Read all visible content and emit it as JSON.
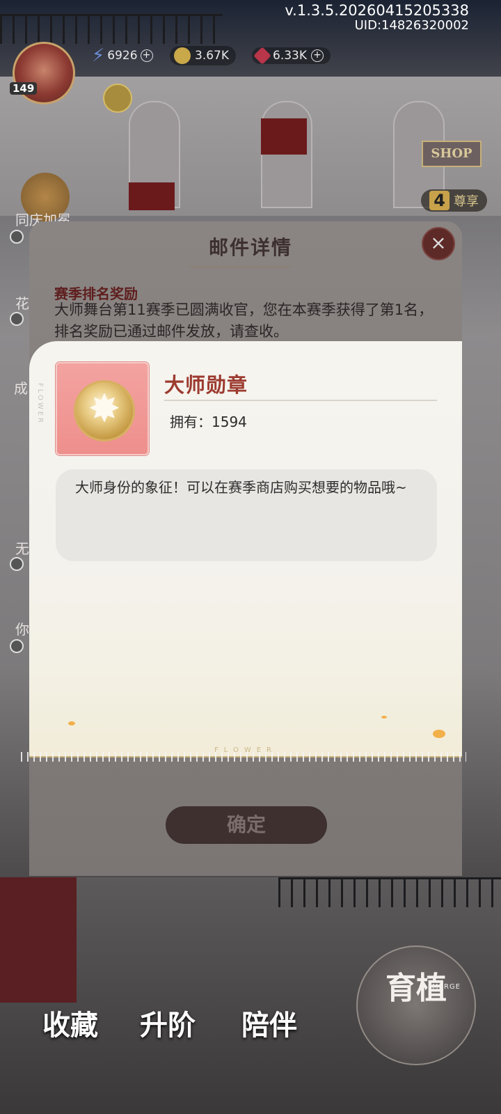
{
  "hud": {
    "version": "v.1.3.5.20260415205338",
    "uid": "UID:14826320002",
    "level": "149",
    "energy": "6926",
    "coins": "3.67K",
    "gems": "6.33K",
    "shop_label": "SHOP",
    "rank_number": "4",
    "rank_label": "尊享"
  },
  "side_labels": [
    "同庆加冕",
    "花",
    "成",
    "无",
    "你"
  ],
  "mail": {
    "title": "邮件详情",
    "close_icon": "close-icon",
    "subject": "赛季排名奖励",
    "body": "大师舞台第11赛季已圆满收官，您在本赛季获得了第1名，排名奖励已通过邮件发放，请查收。",
    "confirm_label": "确定"
  },
  "item": {
    "name": "大师勋章",
    "own_label": "拥有：1594",
    "description": "大师身份的象征！可以在赛季商店购买想要的物品哦~",
    "decor_text": "FLOWER",
    "card_color": "#ef9592"
  },
  "nav": {
    "collect": "收藏",
    "upgrade": "升阶",
    "companion": "陪伴",
    "merge_cn": "育植",
    "merge_en": "MERGE"
  }
}
